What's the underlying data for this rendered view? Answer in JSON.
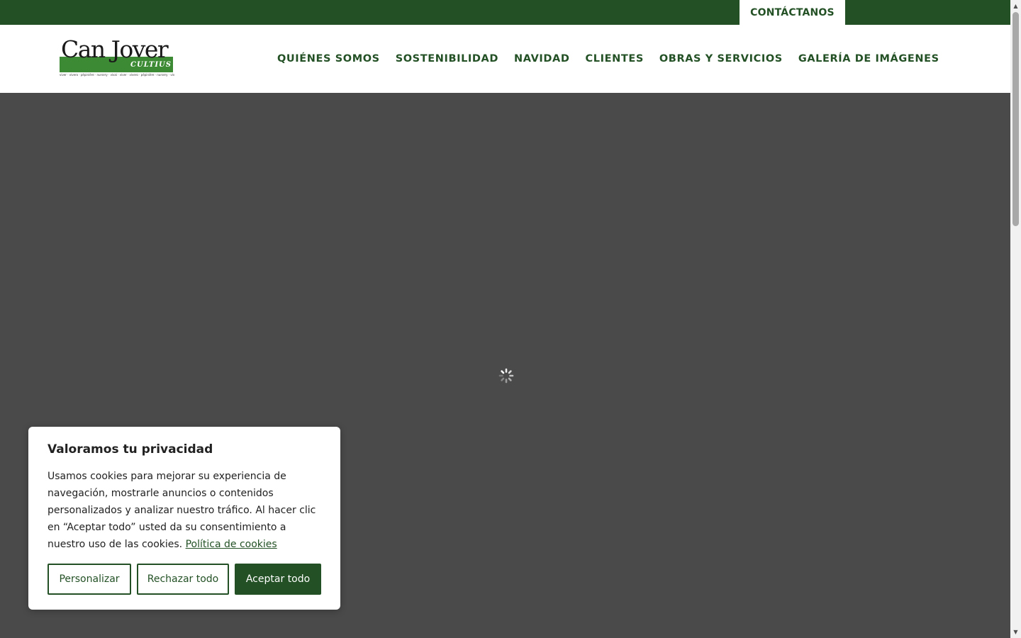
{
  "topbar": {
    "contact_label": "CONTÁCTANOS"
  },
  "logo": {
    "word": "Can Jover",
    "sub": "CULTIUS",
    "tagline": "viver · vivero · pépinière · nursery · vivai · viver · vivero · pépinière · nursery · vivai"
  },
  "nav": {
    "items": [
      {
        "label": "QUIÉNES SOMOS"
      },
      {
        "label": "SOSTENIBILIDAD"
      },
      {
        "label": "NAVIDAD"
      },
      {
        "label": "CLIENTES"
      },
      {
        "label": "OBRAS Y SERVICIOS"
      },
      {
        "label": "GALERÍA DE IMÁGENES"
      }
    ]
  },
  "cookie": {
    "title": "Valoramos tu privacidad",
    "text": "Usamos cookies para mejorar su experiencia de navegación, mostrarle anuncios o contenidos personalizados y analizar nuestro tráfico. Al hacer clic en “Aceptar todo” usted da su consentimiento a nuestro uso de las cookies.",
    "link": "Política de cookies",
    "customize_label": "Personalizar",
    "reject_label": "Rechazar todo",
    "accept_label": "Aceptar todo"
  },
  "colors": {
    "brand_green": "#235125",
    "hero_bg": "#4a4a4a",
    "logo_green": "#3d8a35"
  },
  "icons": {
    "spinner": "loading-spinner-icon",
    "scroll_up": "arrow-up-icon",
    "scroll_down": "arrow-down-icon"
  }
}
